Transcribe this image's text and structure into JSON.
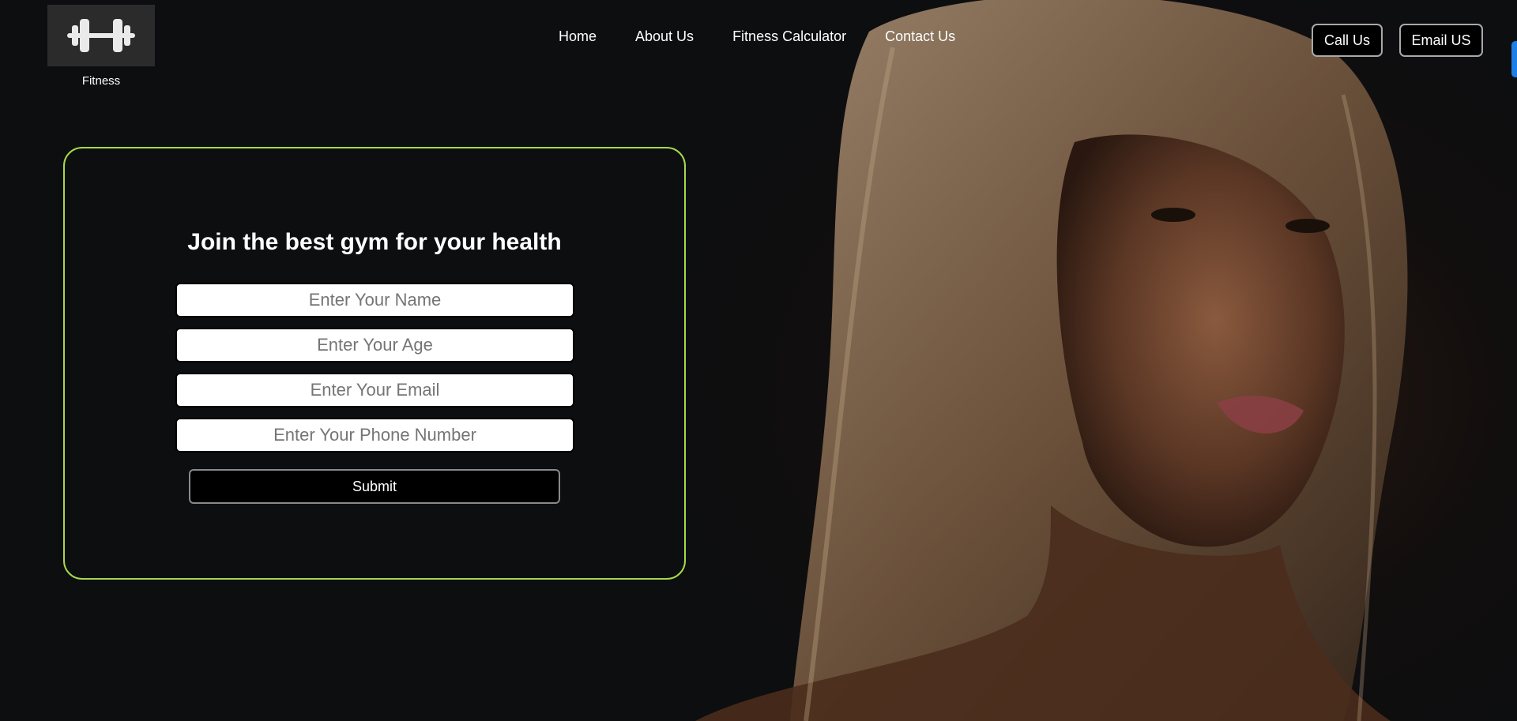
{
  "brand": {
    "logo_icon": "dumbbell-icon",
    "caption": "Fitness"
  },
  "nav": [
    {
      "label": "Home"
    },
    {
      "label": "About Us"
    },
    {
      "label": "Fitness Calculator"
    },
    {
      "label": "Contact Us"
    }
  ],
  "header_buttons": {
    "call": "Call Us",
    "email": "Email US"
  },
  "form": {
    "title": "Join the best gym for your health",
    "fields": [
      {
        "placeholder": "Enter Your Name",
        "value": ""
      },
      {
        "placeholder": "Enter Your Age",
        "value": ""
      },
      {
        "placeholder": "Enter Your Email",
        "value": ""
      },
      {
        "placeholder": "Enter Your Phone Number",
        "value": ""
      }
    ],
    "submit_label": "Submit"
  },
  "colors": {
    "background": "#0d0e10",
    "card_border": "#a6d94a",
    "edge_tab": "#1e7fe6"
  }
}
